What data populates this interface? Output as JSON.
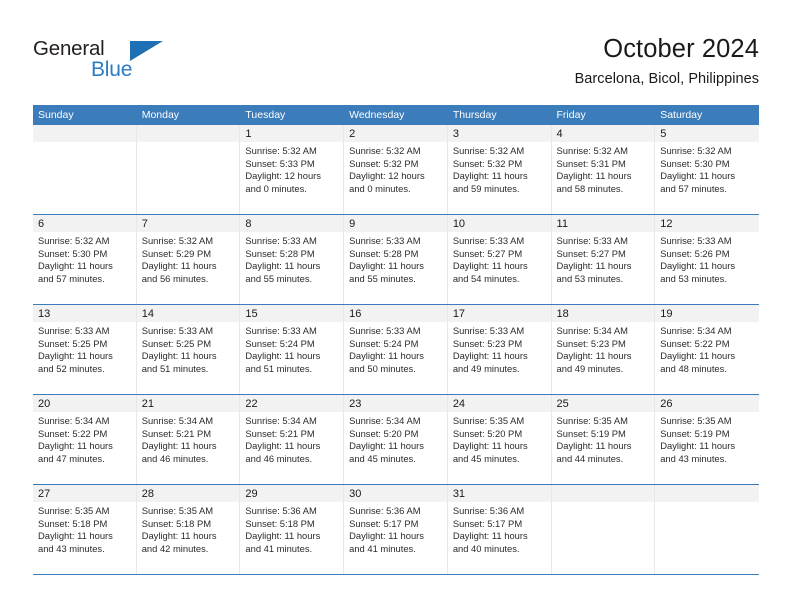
{
  "brand": {
    "name_top": "General",
    "name_bottom": "Blue",
    "triangle_color": "#1f6fb5",
    "text_color": "#231f20",
    "blue_color": "#2b7cc3"
  },
  "header": {
    "title": "October 2024",
    "subtitle": "Barcelona, Bicol, Philippines"
  },
  "theme": {
    "header_band": "#3b7cba",
    "day_strip": "#f2f2f2",
    "row_divider": "#3b7cba"
  },
  "weekdays": [
    "Sunday",
    "Monday",
    "Tuesday",
    "Wednesday",
    "Thursday",
    "Friday",
    "Saturday"
  ],
  "weeks": [
    [
      {
        "day": "",
        "sunrise": "",
        "sunset": "",
        "daylight1": "",
        "daylight2": ""
      },
      {
        "day": "",
        "sunrise": "",
        "sunset": "",
        "daylight1": "",
        "daylight2": ""
      },
      {
        "day": "1",
        "sunrise": "Sunrise: 5:32 AM",
        "sunset": "Sunset: 5:33 PM",
        "daylight1": "Daylight: 12 hours",
        "daylight2": "and 0 minutes."
      },
      {
        "day": "2",
        "sunrise": "Sunrise: 5:32 AM",
        "sunset": "Sunset: 5:32 PM",
        "daylight1": "Daylight: 12 hours",
        "daylight2": "and 0 minutes."
      },
      {
        "day": "3",
        "sunrise": "Sunrise: 5:32 AM",
        "sunset": "Sunset: 5:32 PM",
        "daylight1": "Daylight: 11 hours",
        "daylight2": "and 59 minutes."
      },
      {
        "day": "4",
        "sunrise": "Sunrise: 5:32 AM",
        "sunset": "Sunset: 5:31 PM",
        "daylight1": "Daylight: 11 hours",
        "daylight2": "and 58 minutes."
      },
      {
        "day": "5",
        "sunrise": "Sunrise: 5:32 AM",
        "sunset": "Sunset: 5:30 PM",
        "daylight1": "Daylight: 11 hours",
        "daylight2": "and 57 minutes."
      }
    ],
    [
      {
        "day": "6",
        "sunrise": "Sunrise: 5:32 AM",
        "sunset": "Sunset: 5:30 PM",
        "daylight1": "Daylight: 11 hours",
        "daylight2": "and 57 minutes."
      },
      {
        "day": "7",
        "sunrise": "Sunrise: 5:32 AM",
        "sunset": "Sunset: 5:29 PM",
        "daylight1": "Daylight: 11 hours",
        "daylight2": "and 56 minutes."
      },
      {
        "day": "8",
        "sunrise": "Sunrise: 5:33 AM",
        "sunset": "Sunset: 5:28 PM",
        "daylight1": "Daylight: 11 hours",
        "daylight2": "and 55 minutes."
      },
      {
        "day": "9",
        "sunrise": "Sunrise: 5:33 AM",
        "sunset": "Sunset: 5:28 PM",
        "daylight1": "Daylight: 11 hours",
        "daylight2": "and 55 minutes."
      },
      {
        "day": "10",
        "sunrise": "Sunrise: 5:33 AM",
        "sunset": "Sunset: 5:27 PM",
        "daylight1": "Daylight: 11 hours",
        "daylight2": "and 54 minutes."
      },
      {
        "day": "11",
        "sunrise": "Sunrise: 5:33 AM",
        "sunset": "Sunset: 5:27 PM",
        "daylight1": "Daylight: 11 hours",
        "daylight2": "and 53 minutes."
      },
      {
        "day": "12",
        "sunrise": "Sunrise: 5:33 AM",
        "sunset": "Sunset: 5:26 PM",
        "daylight1": "Daylight: 11 hours",
        "daylight2": "and 53 minutes."
      }
    ],
    [
      {
        "day": "13",
        "sunrise": "Sunrise: 5:33 AM",
        "sunset": "Sunset: 5:25 PM",
        "daylight1": "Daylight: 11 hours",
        "daylight2": "and 52 minutes."
      },
      {
        "day": "14",
        "sunrise": "Sunrise: 5:33 AM",
        "sunset": "Sunset: 5:25 PM",
        "daylight1": "Daylight: 11 hours",
        "daylight2": "and 51 minutes."
      },
      {
        "day": "15",
        "sunrise": "Sunrise: 5:33 AM",
        "sunset": "Sunset: 5:24 PM",
        "daylight1": "Daylight: 11 hours",
        "daylight2": "and 51 minutes."
      },
      {
        "day": "16",
        "sunrise": "Sunrise: 5:33 AM",
        "sunset": "Sunset: 5:24 PM",
        "daylight1": "Daylight: 11 hours",
        "daylight2": "and 50 minutes."
      },
      {
        "day": "17",
        "sunrise": "Sunrise: 5:33 AM",
        "sunset": "Sunset: 5:23 PM",
        "daylight1": "Daylight: 11 hours",
        "daylight2": "and 49 minutes."
      },
      {
        "day": "18",
        "sunrise": "Sunrise: 5:34 AM",
        "sunset": "Sunset: 5:23 PM",
        "daylight1": "Daylight: 11 hours",
        "daylight2": "and 49 minutes."
      },
      {
        "day": "19",
        "sunrise": "Sunrise: 5:34 AM",
        "sunset": "Sunset: 5:22 PM",
        "daylight1": "Daylight: 11 hours",
        "daylight2": "and 48 minutes."
      }
    ],
    [
      {
        "day": "20",
        "sunrise": "Sunrise: 5:34 AM",
        "sunset": "Sunset: 5:22 PM",
        "daylight1": "Daylight: 11 hours",
        "daylight2": "and 47 minutes."
      },
      {
        "day": "21",
        "sunrise": "Sunrise: 5:34 AM",
        "sunset": "Sunset: 5:21 PM",
        "daylight1": "Daylight: 11 hours",
        "daylight2": "and 46 minutes."
      },
      {
        "day": "22",
        "sunrise": "Sunrise: 5:34 AM",
        "sunset": "Sunset: 5:21 PM",
        "daylight1": "Daylight: 11 hours",
        "daylight2": "and 46 minutes."
      },
      {
        "day": "23",
        "sunrise": "Sunrise: 5:34 AM",
        "sunset": "Sunset: 5:20 PM",
        "daylight1": "Daylight: 11 hours",
        "daylight2": "and 45 minutes."
      },
      {
        "day": "24",
        "sunrise": "Sunrise: 5:35 AM",
        "sunset": "Sunset: 5:20 PM",
        "daylight1": "Daylight: 11 hours",
        "daylight2": "and 45 minutes."
      },
      {
        "day": "25",
        "sunrise": "Sunrise: 5:35 AM",
        "sunset": "Sunset: 5:19 PM",
        "daylight1": "Daylight: 11 hours",
        "daylight2": "and 44 minutes."
      },
      {
        "day": "26",
        "sunrise": "Sunrise: 5:35 AM",
        "sunset": "Sunset: 5:19 PM",
        "daylight1": "Daylight: 11 hours",
        "daylight2": "and 43 minutes."
      }
    ],
    [
      {
        "day": "27",
        "sunrise": "Sunrise: 5:35 AM",
        "sunset": "Sunset: 5:18 PM",
        "daylight1": "Daylight: 11 hours",
        "daylight2": "and 43 minutes."
      },
      {
        "day": "28",
        "sunrise": "Sunrise: 5:35 AM",
        "sunset": "Sunset: 5:18 PM",
        "daylight1": "Daylight: 11 hours",
        "daylight2": "and 42 minutes."
      },
      {
        "day": "29",
        "sunrise": "Sunrise: 5:36 AM",
        "sunset": "Sunset: 5:18 PM",
        "daylight1": "Daylight: 11 hours",
        "daylight2": "and 41 minutes."
      },
      {
        "day": "30",
        "sunrise": "Sunrise: 5:36 AM",
        "sunset": "Sunset: 5:17 PM",
        "daylight1": "Daylight: 11 hours",
        "daylight2": "and 41 minutes."
      },
      {
        "day": "31",
        "sunrise": "Sunrise: 5:36 AM",
        "sunset": "Sunset: 5:17 PM",
        "daylight1": "Daylight: 11 hours",
        "daylight2": "and 40 minutes."
      },
      {
        "day": "",
        "sunrise": "",
        "sunset": "",
        "daylight1": "",
        "daylight2": ""
      },
      {
        "day": "",
        "sunrise": "",
        "sunset": "",
        "daylight1": "",
        "daylight2": ""
      }
    ]
  ]
}
